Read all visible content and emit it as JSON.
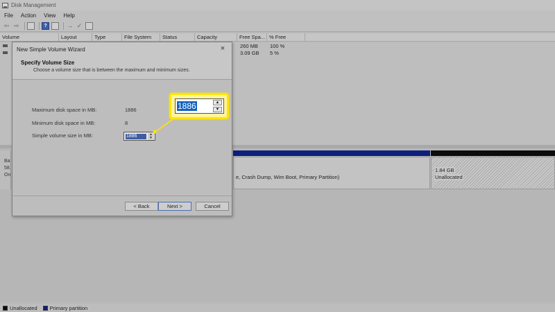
{
  "window": {
    "title": "Disk Management"
  },
  "menu": [
    "File",
    "Action",
    "View",
    "Help"
  ],
  "toolbar": {
    "icons": [
      "back-arrow-icon",
      "forward-arrow-icon",
      "list-view-icon",
      "help-icon",
      "properties-icon",
      "disconnect-icon",
      "checkmark-icon",
      "grid-icon"
    ]
  },
  "volume_list": {
    "columns": [
      "Volume",
      "Layout",
      "Type",
      "File System",
      "Status",
      "Capacity",
      "Free Spa...",
      "% Free"
    ],
    "rows": [
      {
        "free_space": "260 MB",
        "percent_free": "100 %"
      },
      {
        "free_space": "3.09 GB",
        "percent_free": "5 %"
      }
    ]
  },
  "disk": {
    "label_lines": [
      "Ba",
      "58.",
      "On"
    ],
    "primary_partition_text": "e, Crash Dump, Wim Boot, Primary Partition)",
    "unallocated": {
      "size": "1.84 GB",
      "label": "Unallocated"
    }
  },
  "legend": {
    "items": [
      {
        "label": "Unallocated",
        "color": "#0c0c0c"
      },
      {
        "label": "Primary partition",
        "color": "#0c1f7e"
      }
    ]
  },
  "wizard": {
    "title": "New Simple Volume Wizard",
    "close_glyph": "×",
    "heading": "Specify Volume Size",
    "subheading": "Choose a volume size that is between the maximum and minimum sizes.",
    "max_label": "Maximum disk space in MB:",
    "max_value": "1886",
    "min_label": "Minimum disk space in MB:",
    "min_value": "8",
    "size_label": "Simple volume size in MB:",
    "size_value": "1886",
    "buttons": {
      "back": "< Back",
      "next": "Next >",
      "cancel": "Cancel"
    }
  },
  "callout": {
    "value": "1886",
    "highlight_color": "#ffe400"
  },
  "colors": {
    "primary_partition": "#0c1f7e",
    "unallocated": "#0c0c0c",
    "selection": "#1564c0"
  }
}
